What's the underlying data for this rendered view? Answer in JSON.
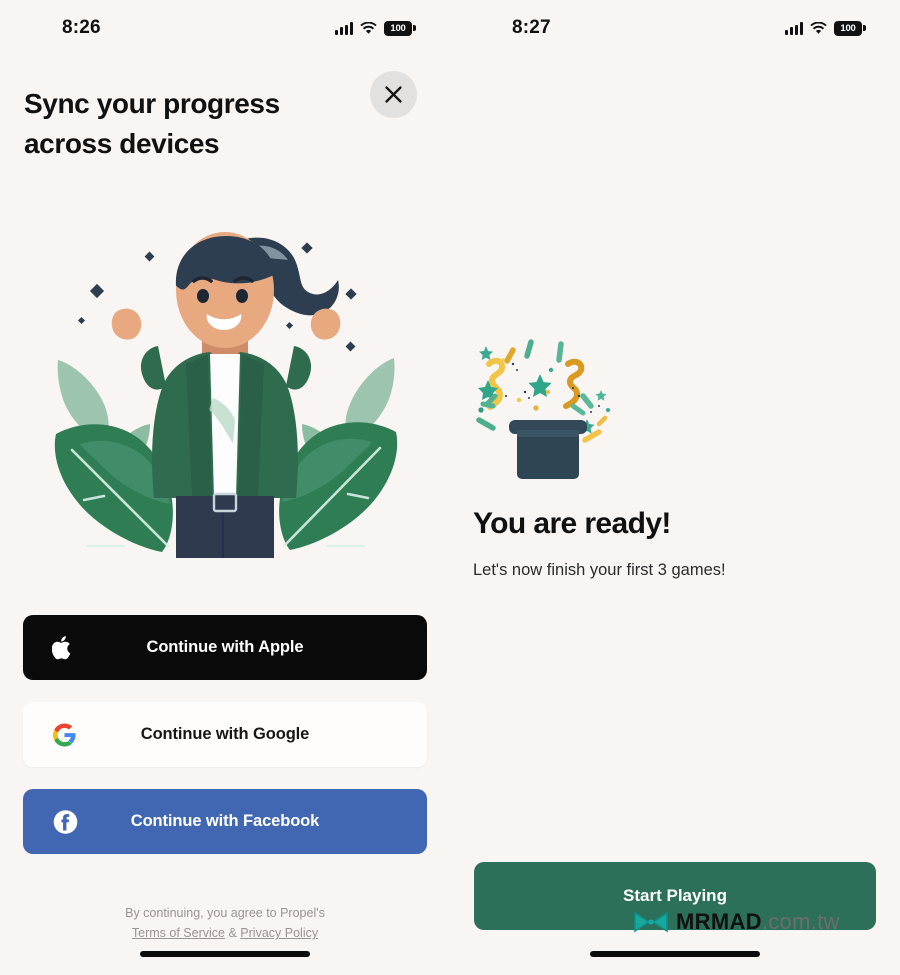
{
  "left_screen": {
    "status_bar": {
      "time": "8:26",
      "battery_level": "100",
      "signal_icon": "cellular-bars-icon",
      "wifi_icon": "wifi-icon"
    },
    "headline": "Sync your progress across devices",
    "close_label": "✕",
    "illustration": {
      "name": "celebrating-woman-illustration",
      "description": "Woman with ponytail raising fists in celebration surrounded by green leaves",
      "colors": {
        "jacket": "#2f6b4f",
        "skin": "#e8a980",
        "hair": "#2c3e50",
        "pants": "#2f3a4e",
        "leaf_dark": "#2f7d55",
        "leaf_light": "#8fbfa4"
      }
    },
    "auth_buttons": [
      {
        "id": "apple",
        "label": "Continue with Apple",
        "icon": "apple-logo-icon",
        "bg": "#0a0a0a",
        "fg": "#ffffff"
      },
      {
        "id": "google",
        "label": "Continue with Google",
        "icon": "google-logo-icon",
        "bg": "#fffdfb",
        "fg": "#171717"
      },
      {
        "id": "facebook",
        "label": "Continue with Facebook",
        "icon": "facebook-logo-icon",
        "bg": "#4267b2",
        "fg": "#ffffff"
      }
    ],
    "legal": {
      "prefix": "By continuing, you agree to Propel's",
      "terms": "Terms of Service",
      "separator": " & ",
      "privacy": "Privacy Policy"
    }
  },
  "right_screen": {
    "status_bar": {
      "time": "8:27",
      "battery_level": "100",
      "signal_icon": "cellular-bars-icon",
      "wifi_icon": "wifi-icon"
    },
    "illustration": {
      "name": "magic-hat-confetti-illustration",
      "description": "Dark magic top hat with gold squiggles, teal stars and confetti bursting out",
      "colors": {
        "hat": "#2e4553",
        "gold": "#e8a020",
        "yellow": "#f0c548",
        "teal": "#2aa municipality"
      }
    },
    "title": "You are ready!",
    "subtitle": "Let's now finish your first 3 games!",
    "start_button": {
      "label": "Start Playing",
      "bg": "#2d7059",
      "fg": "#ffffff"
    }
  },
  "watermark": {
    "brand": "MRMAD",
    "domain": ".com.tw",
    "logo_icon": "mrmad-butterfly-logo-icon",
    "color": "#17a098"
  },
  "theme": {
    "background": "#f8f5f2",
    "text": "#111111",
    "muted": "#9a9490"
  }
}
